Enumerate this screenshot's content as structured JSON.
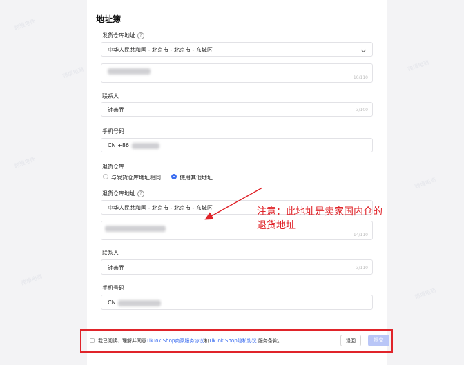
{
  "section_title": "地址簿",
  "ship_warehouse": {
    "label": "发货仓库地址",
    "region_value": "中华人民共和国 - 北京市 - 北京市 - 东城区",
    "address_counter": "10/110"
  },
  "contact_1": {
    "label": "联系人",
    "value": "钟燕乔",
    "counter": "3/100"
  },
  "phone_1": {
    "label": "手机号码",
    "prefix": "CN +86"
  },
  "return_warehouse": {
    "label": "退货仓库",
    "options": [
      "与发货仓库地址相同",
      "使用其他地址"
    ],
    "selected_index": 1
  },
  "return_address": {
    "label": "退货仓库地址",
    "region_value": "中华人民共和国 - 北京市 - 北京市 - 东城区",
    "address_counter": "14/110"
  },
  "contact_2": {
    "label": "联系人",
    "value": "钟燕乔",
    "counter": "3/110"
  },
  "phone_2": {
    "label": "手机号码",
    "prefix": "CN"
  },
  "annotation": {
    "line1": "注意：此地址是卖家国内仓的",
    "line2": "退货地址",
    "color": "#e0242a"
  },
  "footer": {
    "agree_prefix": "我已阅读、理解并同意",
    "link1": "TikTok Shop商家服务协议",
    "connector": "和",
    "link2": "TikTok Shop隐私协议",
    "agree_suffix": " 服务条款。",
    "back_label": "退回",
    "submit_label": "提交",
    "link_color": "#3b6df0"
  }
}
